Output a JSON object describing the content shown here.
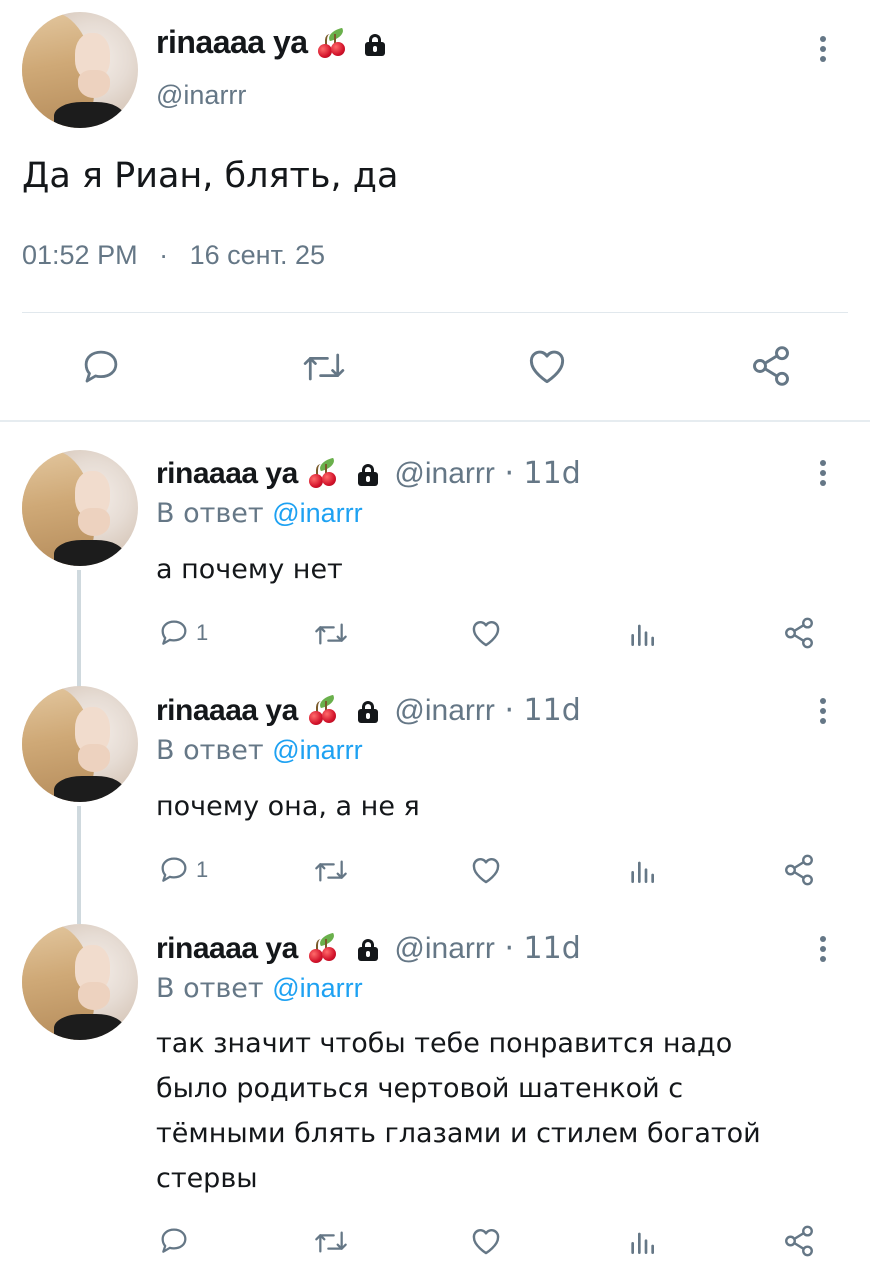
{
  "main_tweet": {
    "display_name": "rinaaaa ya",
    "handle": "@inarrr",
    "text": "Да я Риан, блять, да",
    "time": "01:52 PM",
    "separator": "·",
    "date": "16 сент. 25"
  },
  "replies": [
    {
      "display_name": "rinaaaa ya",
      "handle": "@inarrr",
      "meta_sep": "·",
      "age": "11d",
      "reply_prefix": "В ответ",
      "reply_to": "@inarrr",
      "text_lines": [
        "а почему нет"
      ],
      "reply_count": "1"
    },
    {
      "display_name": "rinaaaa ya",
      "handle": "@inarrr",
      "meta_sep": "·",
      "age": "11d",
      "reply_prefix": "В ответ",
      "reply_to": "@inarrr",
      "text_lines": [
        "почему она, а не я"
      ],
      "reply_count": "1"
    },
    {
      "display_name": "rinaaaa ya",
      "handle": "@inarrr",
      "meta_sep": "·",
      "age": "11d",
      "reply_prefix": "В ответ",
      "reply_to": "@inarrr",
      "text_lines": [
        "так значит чтобы тебе понравится надо",
        "было родиться чертовой шатенкой с",
        "тёмными блять глазами и стилем богатой",
        "стервы"
      ],
      "reply_count": ""
    }
  ],
  "icons": {
    "name_emoji": "cherry-emoji",
    "protected": "lock-icon",
    "more": "more-options-icon",
    "reply": "reply-icon",
    "retweet": "retweet-icon",
    "like": "like-icon",
    "views": "views-icon",
    "share": "share-icon"
  },
  "colors": {
    "text": "#14171a",
    "muted": "#657786",
    "link": "#1da1f2",
    "divider": "#e1e8ed",
    "thread_line": "#cfd9de"
  }
}
